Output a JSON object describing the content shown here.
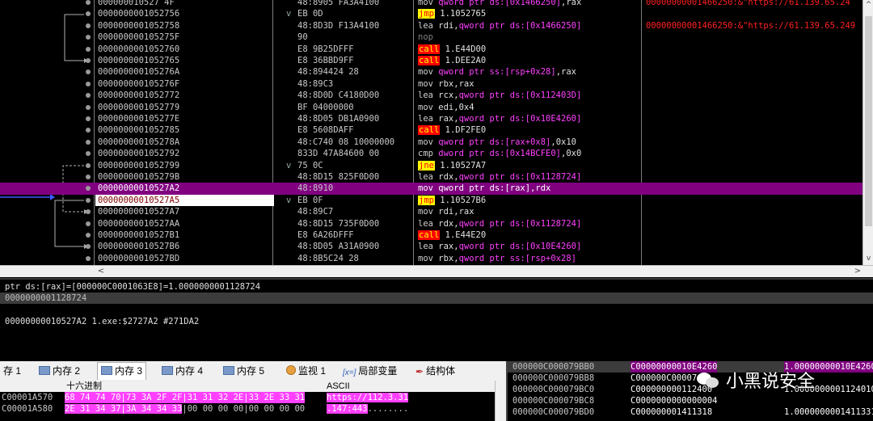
{
  "disasm": {
    "rows": [
      {
        "addr": "000000010527 4F",
        "bytes": "48:8905 FA3A4100",
        "mn": "mov",
        "mnclass": "mov",
        "ops": [
          [
            "o-ptr",
            "qword ptr ds:[0x1466250]"
          ],
          [
            "o-reg",
            ",rax"
          ]
        ],
        "comment": "00000000001466250:&\"https://61.139.65.24"
      },
      {
        "addr": "0000000001052756",
        "bytes": "EB 0D",
        "arrow": "v",
        "mn": "jmp",
        "mnclass": "jmp",
        "ops": [
          [
            "o-num",
            " 1.1052765"
          ]
        ],
        "comment": ""
      },
      {
        "addr": "0000000001052758",
        "bytes": "48:8D3D F13A4100",
        "mn": "lea",
        "mnclass": "lea",
        "ops": [
          [
            "o-reg",
            "rdi,"
          ],
          [
            "o-ptr",
            "qword ptr ds:[0x1466250]"
          ]
        ],
        "comment": "00000000001466250:&\"https://61.139.65.249"
      },
      {
        "addr": "000000000105275F",
        "bytes": "90",
        "mn": "nop",
        "mnclass": "nop",
        "ops": [],
        "comment": ""
      },
      {
        "addr": "0000000001052760",
        "bytes": "E8 9B25DFFF",
        "mn": "call",
        "mnclass": "call",
        "ops": [
          [
            "o-num",
            " 1.E44D00"
          ]
        ],
        "comment": ""
      },
      {
        "addr": "0000000001052765",
        "bytes": "E8 36BBD9FF",
        "mn": "call",
        "mnclass": "call",
        "ops": [
          [
            "o-num",
            " 1.DEE2A0"
          ]
        ],
        "comment": ""
      },
      {
        "addr": "000000000105276A",
        "bytes": "48:894424 28",
        "mn": "mov",
        "mnclass": "mov",
        "ops": [
          [
            "o-ptr",
            " qword ptr ss:[rsp+0x28]"
          ],
          [
            "o-reg",
            ",rax"
          ]
        ],
        "comment": ""
      },
      {
        "addr": "000000000105276F",
        "bytes": "48:89C3",
        "mn": "mov",
        "mnclass": "mov",
        "ops": [
          [
            "o-reg",
            " rbx,rax"
          ]
        ],
        "comment": ""
      },
      {
        "addr": "0000000001052772",
        "bytes": "48:8D0D C4180D00",
        "mn": "lea",
        "mnclass": "lea",
        "ops": [
          [
            "o-reg",
            " rcx,"
          ],
          [
            "o-ptr",
            "qword ptr ds:[0x112403D]"
          ]
        ],
        "comment": ""
      },
      {
        "addr": "0000000001052779",
        "bytes": "BF 04000000",
        "mn": "mov",
        "mnclass": "mov",
        "ops": [
          [
            "o-reg",
            " edi,0x4"
          ]
        ],
        "comment": ""
      },
      {
        "addr": "000000000105277E",
        "bytes": "48:8D05 DB1A0900",
        "mn": "lea",
        "mnclass": "lea",
        "ops": [
          [
            "o-reg",
            " rax,"
          ],
          [
            "o-ptr",
            "qword ptr ds:[0x10E4260]"
          ]
        ],
        "comment": ""
      },
      {
        "addr": "0000000001052785",
        "bytes": "E8 5608DAFF",
        "mn": "call",
        "mnclass": "call",
        "ops": [
          [
            "o-num",
            " 1.DF2FE0"
          ]
        ],
        "comment": ""
      },
      {
        "addr": "000000000105278A",
        "bytes": "48:C740 08 10000000",
        "mn": "mov",
        "mnclass": "mov",
        "ops": [
          [
            "o-ptr",
            " qword ptr ds:[rax+0x8]"
          ],
          [
            "o-reg",
            ",0x10"
          ]
        ],
        "comment": ""
      },
      {
        "addr": "0000000001052792",
        "bytes": "833D 47A84600 00",
        "mn": "cmp",
        "mnclass": "cmp",
        "ops": [
          [
            "o-ptr",
            " dword ptr ds:[0x14BCFE0]"
          ],
          [
            "o-reg",
            ",0x0"
          ]
        ],
        "comment": ""
      },
      {
        "addr": "0000000001052799",
        "bytes": "75 0C",
        "arrow": "v",
        "mn": "jne",
        "mnclass": "jne",
        "ops": [
          [
            "o-num",
            " 1.10527A7"
          ]
        ],
        "comment": ""
      },
      {
        "addr": "000000000105279B",
        "bytes": "48:8D15 825F0D00",
        "mn": "lea",
        "mnclass": "lea",
        "ops": [
          [
            "o-reg",
            " rdx,"
          ],
          [
            "o-ptr",
            "qword ptr ds:[0x1128724]"
          ]
        ],
        "comment": ""
      },
      {
        "addr": "00000000010527A2",
        "bytes": "48:8910",
        "mn": "mov",
        "mnclass": "mov",
        "ops": [
          [
            "o-ptr",
            " qword ptr ds:[rax]"
          ],
          [
            "o-reg",
            ",rdx"
          ]
        ],
        "comment": "",
        "sel": true
      },
      {
        "addr": "00000000010527A5",
        "bytes": "EB 0F",
        "arrow": "v",
        "mn": "jmp",
        "mnclass": "jmp",
        "ops": [
          [
            "o-num",
            " 1.10527B6"
          ]
        ],
        "comment": "",
        "eip": true
      },
      {
        "addr": "00000000010527A7",
        "bytes": "48:89C7",
        "mn": "mov",
        "mnclass": "mov",
        "ops": [
          [
            "o-reg",
            " rdi,rax"
          ]
        ],
        "comment": ""
      },
      {
        "addr": "00000000010527AA",
        "bytes": "48:8D15 735F0D00",
        "mn": "lea",
        "mnclass": "lea",
        "ops": [
          [
            "o-reg",
            " rdx,"
          ],
          [
            "o-ptr",
            "qword ptr ds:[0x1128724]"
          ]
        ],
        "comment": ""
      },
      {
        "addr": "00000000010527B1",
        "bytes": "E8 6A26DFFF",
        "mn": "call",
        "mnclass": "call",
        "ops": [
          [
            "o-num",
            " 1.E44E20"
          ]
        ],
        "comment": ""
      },
      {
        "addr": "00000000010527B6",
        "bytes": "48:8D05 A31A0900",
        "mn": "lea",
        "mnclass": "lea",
        "ops": [
          [
            "o-reg",
            " rax,"
          ],
          [
            "o-ptr",
            "qword ptr ds:[0x10E4260]"
          ]
        ],
        "comment": ""
      },
      {
        "addr": "00000000010527BD",
        "bytes": "48:8B5C24 28",
        "mn": "mov",
        "mnclass": "mov",
        "ops": [
          [
            "o-reg",
            " rbx,"
          ],
          [
            "o-ptr",
            "qword ptr ss:[rsp+0x28]"
          ]
        ],
        "comment": ""
      }
    ]
  },
  "info": {
    "line1": "ptr ds:[rax]=[000000C0001063E8]=1.0000000001128724",
    "line2": "0000000001128724",
    "line3": "00000000010527A2 1.exe:$2727A2 #271DA2"
  },
  "tabs": [
    {
      "label": "存 1",
      "icon": "none"
    },
    {
      "label": "内存 2",
      "icon": "memory-icon"
    },
    {
      "label": "内存 3",
      "icon": "memory-icon",
      "active": true
    },
    {
      "label": "内存 4",
      "icon": "memory-icon"
    },
    {
      "label": "内存 5",
      "icon": "memory-icon"
    },
    {
      "label": "监视 1",
      "icon": "watch-icon"
    },
    {
      "label": "局部变量",
      "icon": "locals-icon",
      "icon_text": "[x=]"
    },
    {
      "label": "结构体",
      "icon": "struct-icon"
    }
  ],
  "dump": {
    "hdr_hex": "十六进制",
    "hdr_ascii": "ASCII",
    "rows": [
      {
        "addr": "C00001A570",
        "hex": "68 74 74 70|73 3A 2F 2F|31 31 32 2E|33 2E 33 31",
        "ascii": "https://112.3.31"
      },
      {
        "addr": "C00001A580",
        "hex": "2E 31 34 37|3A 34 34 33",
        "hex2": "|00 00 00 00|00 00 00 00",
        "ascii": ".147:443",
        "ascii2": "........"
      }
    ]
  },
  "stack": {
    "rows": [
      {
        "addr": "000000C000079BB0",
        "val": "C00000000010E4260",
        "cmt": "1.00000000010E4260",
        "top": true
      },
      {
        "addr": "000000C000079BB8",
        "val": "C000000C00007",
        "cmt": ""
      },
      {
        "addr": "000000C000079BC0",
        "val": "C000000000112400",
        "cmt": "1.0000000001124010"
      },
      {
        "addr": "000000C000079BC8",
        "val": "C0000000000000004",
        "cmt": ""
      },
      {
        "addr": "000000C000079BD0",
        "val": "C000000001411318",
        "cmt": "1.0000000001411331"
      }
    ]
  },
  "watermark": {
    "text": "小黑说安全",
    "icon": "wechat-icon"
  }
}
